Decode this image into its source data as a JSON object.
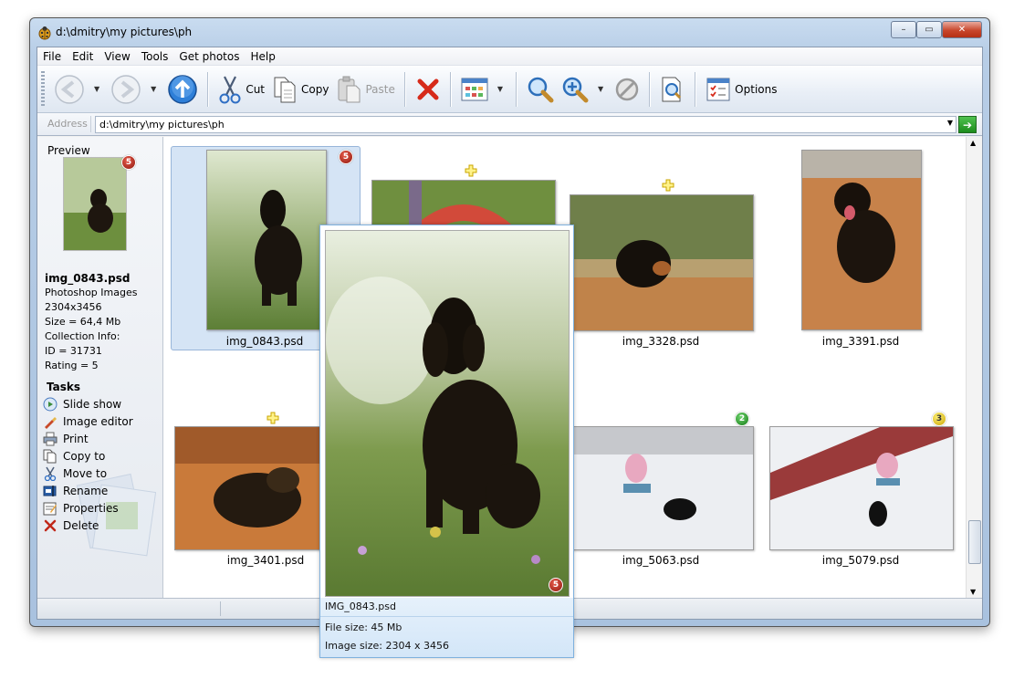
{
  "window": {
    "title": "d:\\dmitry\\my pictures\\ph",
    "minimize_glyph": "–",
    "maximize_glyph": "▭",
    "close_glyph": "✕"
  },
  "menu": [
    "File",
    "Edit",
    "View",
    "Tools",
    "Get photos",
    "Help"
  ],
  "toolbar": {
    "cut_label": "Cut",
    "copy_label": "Copy",
    "paste_label": "Paste",
    "options_label": "Options"
  },
  "address": {
    "label": "Address",
    "value": "d:\\dmitry\\my pictures\\ph"
  },
  "preview": {
    "label": "Preview",
    "rating_badge": "5"
  },
  "file_info": {
    "name": "img_0843.psd",
    "type": "Photoshop Images",
    "dimensions": "2304x3456",
    "size": "Size = 64,4 Mb",
    "collection": "Collection Info:",
    "id": "ID = 31731",
    "rating": "Rating = 5"
  },
  "tasks": {
    "title": "Tasks",
    "items": [
      "Slide show",
      "Image editor",
      "Print",
      "Copy to",
      "Move to",
      "Rename",
      "Properties",
      "Delete"
    ]
  },
  "thumbnails": [
    {
      "name": "img_0843.psd",
      "badge": "5",
      "badge_color": "red"
    },
    {
      "name": "",
      "badge": "+",
      "badge_color": "plus"
    },
    {
      "name": "img_3328.psd",
      "badge": "+",
      "badge_color": "plus"
    },
    {
      "name": "img_3391.psd",
      "badge": "+",
      "badge_color": "plus"
    },
    {
      "name": "img_3401.psd",
      "badge": "+",
      "badge_color": "plus"
    },
    {
      "name": "img_5063.psd",
      "badge": "2",
      "badge_color": "green"
    },
    {
      "name": "img_5079.psd",
      "badge": "3",
      "badge_color": "yellow"
    }
  ],
  "popup": {
    "filename": "IMG_0843.psd",
    "file_size": "File size: 45 Mb",
    "image_size": "Image size: 2304 x 3456",
    "badge": "5"
  },
  "colors": {
    "selection": "#d5e4f5",
    "popup_border": "#7fb1de",
    "badge_red": "#b82a1c",
    "badge_green": "#2e9e2e",
    "badge_yellow": "#e5c20c"
  }
}
